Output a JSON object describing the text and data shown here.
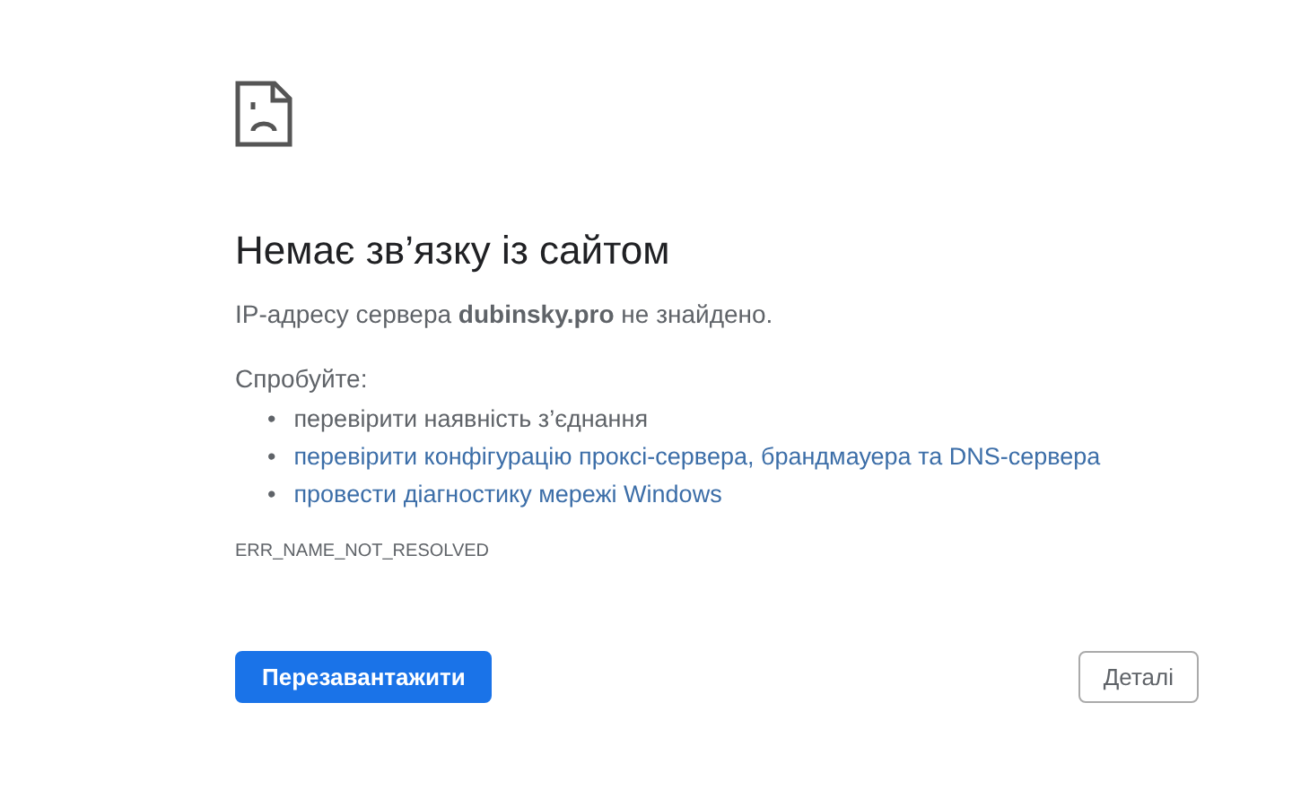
{
  "heading": "Немає зв’язку із сайтом",
  "message": "IP-адресу сервера **dubinsky.pro** не знайдено.",
  "suggestions_title": "Спробуйте:",
  "suggestions": [
    {
      "kind": "text",
      "bullet": "•",
      "label": "перевірити наявність з’єднання"
    },
    {
      "kind": "link",
      "bullet": "•",
      "label": "перевірити конфігурацію проксі-сервера, брандмауера та DNS-сервера"
    },
    {
      "kind": "link",
      "bullet": "•",
      "label": "провести діагностику мережі Windows"
    }
  ],
  "error_code": "ERR_NAME_NOT_RESOLVED",
  "buttons": [
    {
      "kind": "primary",
      "label": "Перезавантажити"
    },
    {
      "kind": "secondary",
      "label": "Деталі"
    }
  ]
}
